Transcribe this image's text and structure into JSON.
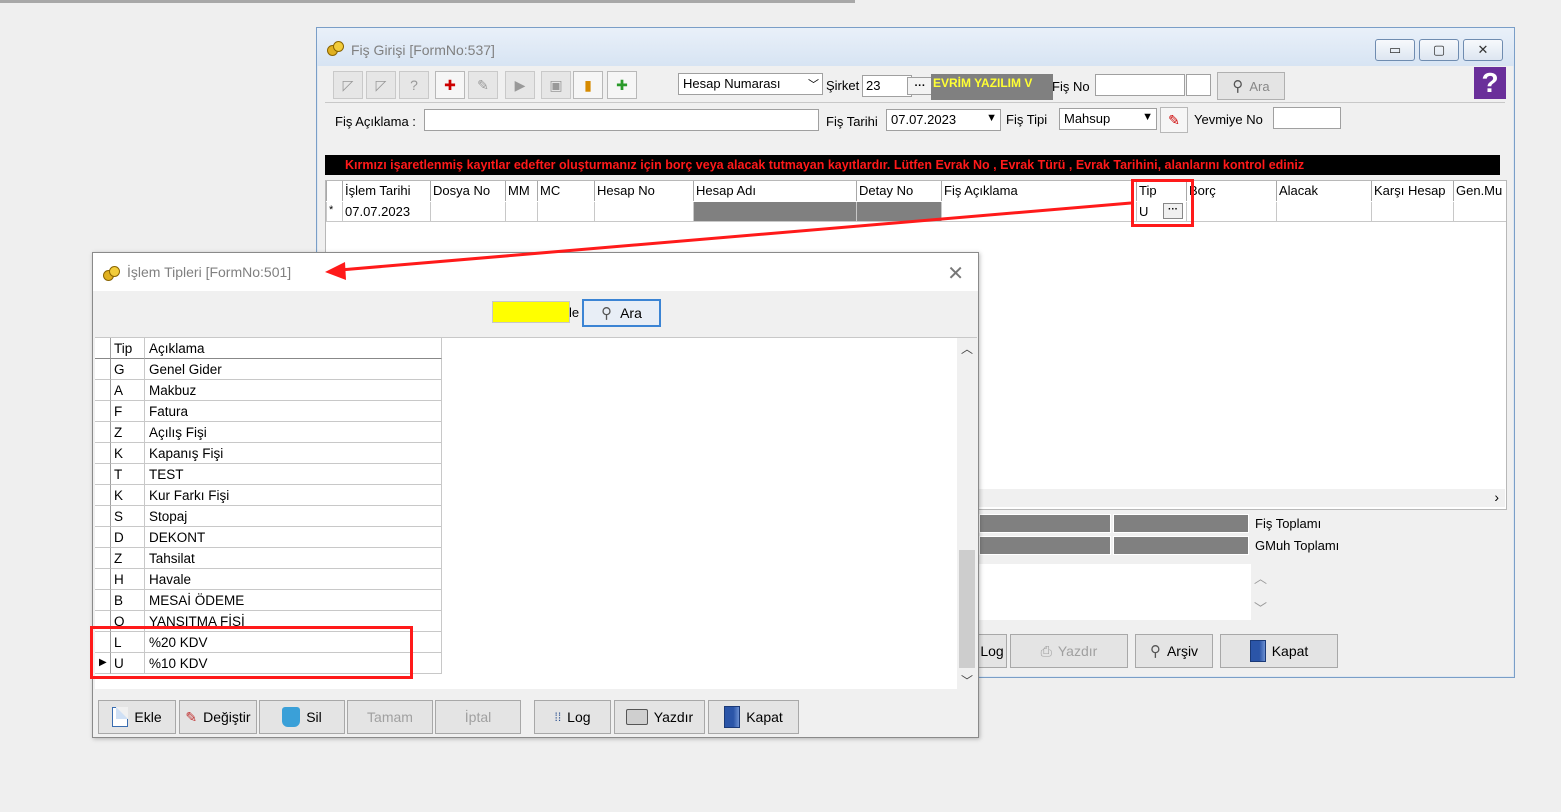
{
  "main_window": {
    "title": "Fiş Girişi [FormNo:537]",
    "controls": {
      "minimize": "▭",
      "maximize": "▢",
      "close": "✕"
    },
    "toolbar": {
      "search_by": "Hesap Numarası",
      "sirket_label": "Şirket",
      "sirket_value": "23",
      "company_name": "EVRİM YAZILIM  V",
      "fis_no_label": "Fiş No",
      "fis_no_value": "",
      "ara_label": "Ara",
      "help": "?"
    },
    "form": {
      "fis_aciklama_label": "Fiş Açıklama :",
      "fis_aciklama_value": "",
      "fis_tarihi_label": "Fiş Tarihi",
      "fis_tarihi_value": "07.07.2023",
      "fis_tipi_label": "Fiş  Tipi",
      "fis_tipi_value": "Mahsup",
      "yevmiye_no_label": "Yevmiye No",
      "yevmiye_no_value": ""
    },
    "banner": "Kırmızı işaretlenmiş kayıtlar edefter oluşturmanız için borç veya alacak tutmayan kayıtlardır. Lütfen Evrak No ,  Evrak Türü , Evrak Tarihini,  alanlarını kontrol ediniz",
    "grid": {
      "columns": [
        "İşlem Tarihi",
        "Dosya No",
        "MM",
        "MC",
        "Hesap No",
        "Hesap Adı",
        "Detay No",
        "Fiş Açıklama",
        "Tip",
        "Borç",
        "Alacak",
        "Karşı Hesap",
        "Gen.Mu"
      ],
      "row": {
        "marker": "*",
        "islem_tarihi": "07.07.2023",
        "tip": "U",
        "tip_button": "···"
      }
    },
    "totals": {
      "fis_toplami": "Fiş Toplamı",
      "gmuh_toplami": "GMuh Toplamı"
    },
    "buttons": {
      "log": "Log",
      "yazdir": "Yazdır",
      "arsiv": "Arşiv",
      "kapat": "Kapat"
    }
  },
  "dialog": {
    "title": "İşlem Tipleri [FormNo:501]",
    "close": "✕",
    "search_value": "",
    "search_suffix": "le",
    "ara_label": "Ara",
    "columns": {
      "tip": "Tip",
      "aciklama": "Açıklama"
    },
    "rows": [
      {
        "tip": "G",
        "aciklama": "Genel Gider"
      },
      {
        "tip": "A",
        "aciklama": "Makbuz"
      },
      {
        "tip": "F",
        "aciklama": "Fatura"
      },
      {
        "tip": "Z",
        "aciklama": "Açılış Fişi"
      },
      {
        "tip": "K",
        "aciklama": "Kapanış Fişi"
      },
      {
        "tip": "T",
        "aciklama": "TEST"
      },
      {
        "tip": "K",
        "aciklama": "Kur Farkı Fişi"
      },
      {
        "tip": "S",
        "aciklama": "Stopaj"
      },
      {
        "tip": "D",
        "aciklama": "DEKONT"
      },
      {
        "tip": "Z",
        "aciklama": "Tahsilat"
      },
      {
        "tip": "H",
        "aciklama": "Havale"
      },
      {
        "tip": "B",
        "aciklama": "MESAİ ÖDEME"
      },
      {
        "tip": "Q",
        "aciklama": "YANSITMA FİŞİ"
      },
      {
        "tip": "L",
        "aciklama": "%20 KDV"
      },
      {
        "tip": "U",
        "aciklama": "%10 KDV"
      }
    ],
    "selected_row_marker": "▶",
    "buttons": {
      "ekle": "Ekle",
      "degistir": "Değiştir",
      "sil": "Sil",
      "tamam": "Tamam",
      "iptal": "İptal",
      "log": "Log",
      "yazdir": "Yazdır",
      "kapat": "Kapat"
    }
  },
  "colors": {
    "annotation": "#ff1a1a",
    "banner_bg": "#000000",
    "banner_text": "#ff1a1a",
    "company_bg": "#808080",
    "company_text": "#ffff33",
    "search_highlight": "#ffff00"
  }
}
